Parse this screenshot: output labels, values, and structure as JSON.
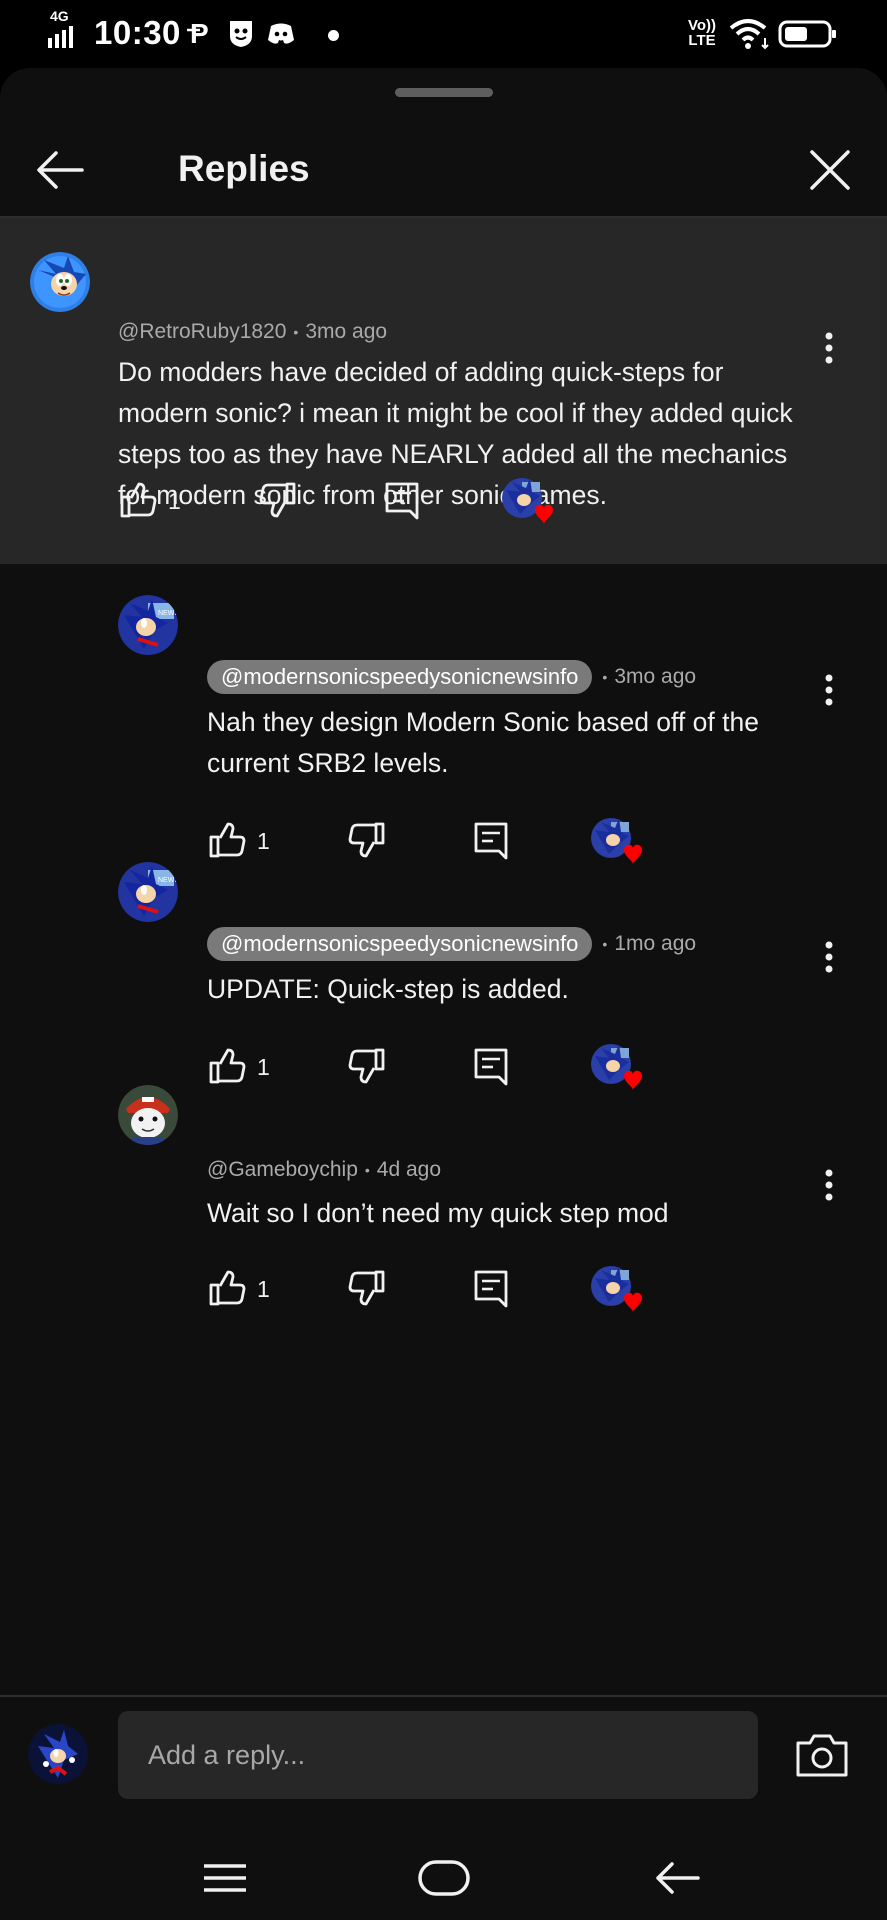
{
  "status_bar": {
    "network": "4G",
    "time": "10:30",
    "volte_top": "Vo))",
    "volte_bottom": "LTE"
  },
  "header": {
    "title": "Replies"
  },
  "parent_comment": {
    "handle": "@RetroRuby1820",
    "age": "3mo ago",
    "text": "Do modders have decided of adding quick-steps for modern sonic? i mean it might be cool if they added quick steps too as they have NEARLY added all the mechanics for modern sonic from other sonic games.",
    "likes": "1",
    "creator_hearted": true
  },
  "replies": [
    {
      "handle": "@modernsonicspeedysonicnewsinfo",
      "is_creator": true,
      "age": "3mo ago",
      "text": "Nah they design Modern Sonic based off of the current SRB2 levels.",
      "likes": "1",
      "creator_hearted": true
    },
    {
      "handle": "@modernsonicspeedysonicnewsinfo",
      "is_creator": true,
      "age": "1mo ago",
      "text": "UPDATE: Quick-step is added.",
      "likes": "1",
      "creator_hearted": true
    },
    {
      "handle": "@Gameboychip",
      "is_creator": false,
      "age": "4d ago",
      "text": "Wait so I don’t need my quick step mod",
      "likes": "1",
      "creator_hearted": true
    }
  ],
  "composer": {
    "placeholder": "Add a reply..."
  },
  "separator": "•",
  "colors": {
    "sheet_bg": "#0f0f0f",
    "parent_bg": "#272727",
    "heart": "#ff0000",
    "creator_pill": "#7a7a7a"
  }
}
